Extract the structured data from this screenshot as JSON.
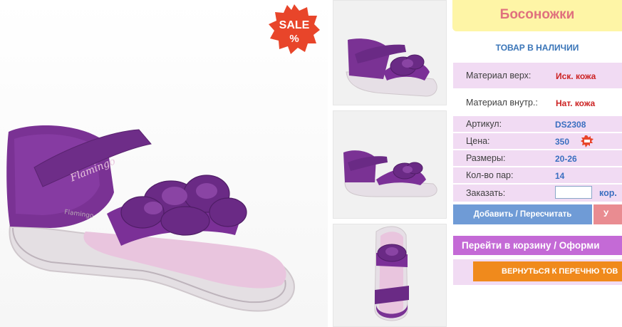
{
  "badge": {
    "sale_label": "SALE",
    "percent_label": "%"
  },
  "product": {
    "title": "Босоножки",
    "stock_status": "ТОВАР В НАЛИЧИИ",
    "brand_text": "Flamingo"
  },
  "specs": {
    "material_upper": {
      "label": "Материал верх:",
      "value": "Иск. кожа"
    },
    "material_inner": {
      "label": "Материал внутр.:",
      "value": "Нат. кожа"
    },
    "article": {
      "label": "Артикул:",
      "value": "DS2308"
    },
    "price": {
      "label": "Цена:",
      "value": "350"
    },
    "sizes": {
      "label": "Размеры:",
      "value": "20-26"
    },
    "pairs": {
      "label": "Кол-во пар:",
      "value": "14"
    }
  },
  "order": {
    "label": "Заказать:",
    "quantity_value": "",
    "unit": "кор."
  },
  "actions": {
    "add_label": "Добавить / Пересчитать",
    "second_label": "У",
    "cart_label": "Перейти в корзину / Оформи",
    "back_label": "ВЕРНУТЬСЯ К ПЕРЕЧНЮ ТОВ"
  },
  "colors": {
    "title_bg": "#fef5a6",
    "title_text": "#e0707e",
    "row_bg": "#f1dbf3",
    "accent_blue": "#3a6fc0",
    "accent_red": "#cc2222",
    "add_button": "#6f9bd6",
    "cart_button": "#c46ad6",
    "back_button": "#f08a1c",
    "sale_badge": "#e8452a"
  },
  "icons": {
    "sale_badge": "sale-burst-icon",
    "price_badge": "sale-small-icon",
    "back_arrow": "arrow-left-icon"
  }
}
